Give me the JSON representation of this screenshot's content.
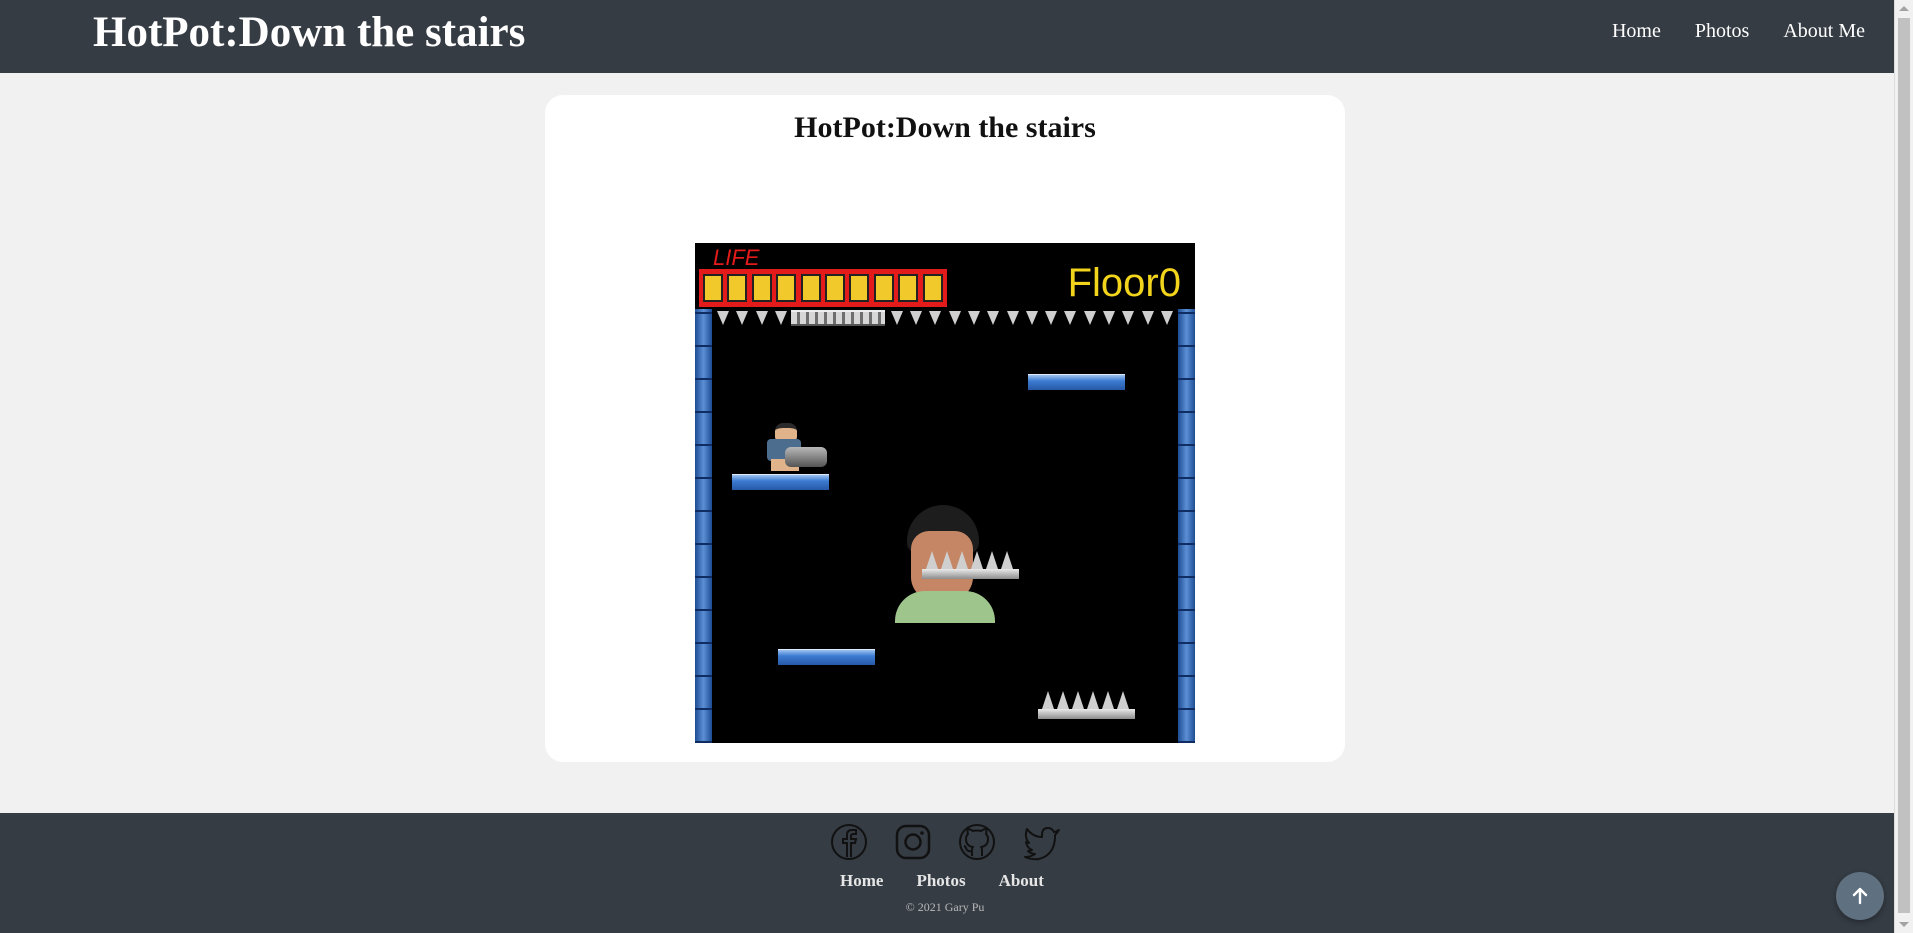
{
  "header": {
    "site_title": "HotPot:Down the stairs",
    "nav": [
      "Home",
      "Photos",
      "About Me"
    ]
  },
  "main": {
    "title": "HotPot:Down the stairs",
    "game": {
      "life_label": "LIFE",
      "life_cells_filled": 10,
      "life_cells_total": 10,
      "floor_text": "Floor0",
      "colors": {
        "life": "#e31b1b",
        "life_cell": "#f1c92a",
        "floor_text": "#f2d41c",
        "platform": "#3c7bd1",
        "background": "#000000"
      }
    }
  },
  "footer": {
    "icons": [
      "facebook-icon",
      "instagram-icon",
      "github-icon",
      "twitter-icon"
    ],
    "links": [
      "Home",
      "Photos",
      "About"
    ],
    "copyright": "© 2021 Gary Pu"
  },
  "colors": {
    "header_bg": "#353c44",
    "page_bg": "#f1f1f1",
    "card_bg": "#ffffff",
    "back_to_top_bg": "#5f7081"
  }
}
